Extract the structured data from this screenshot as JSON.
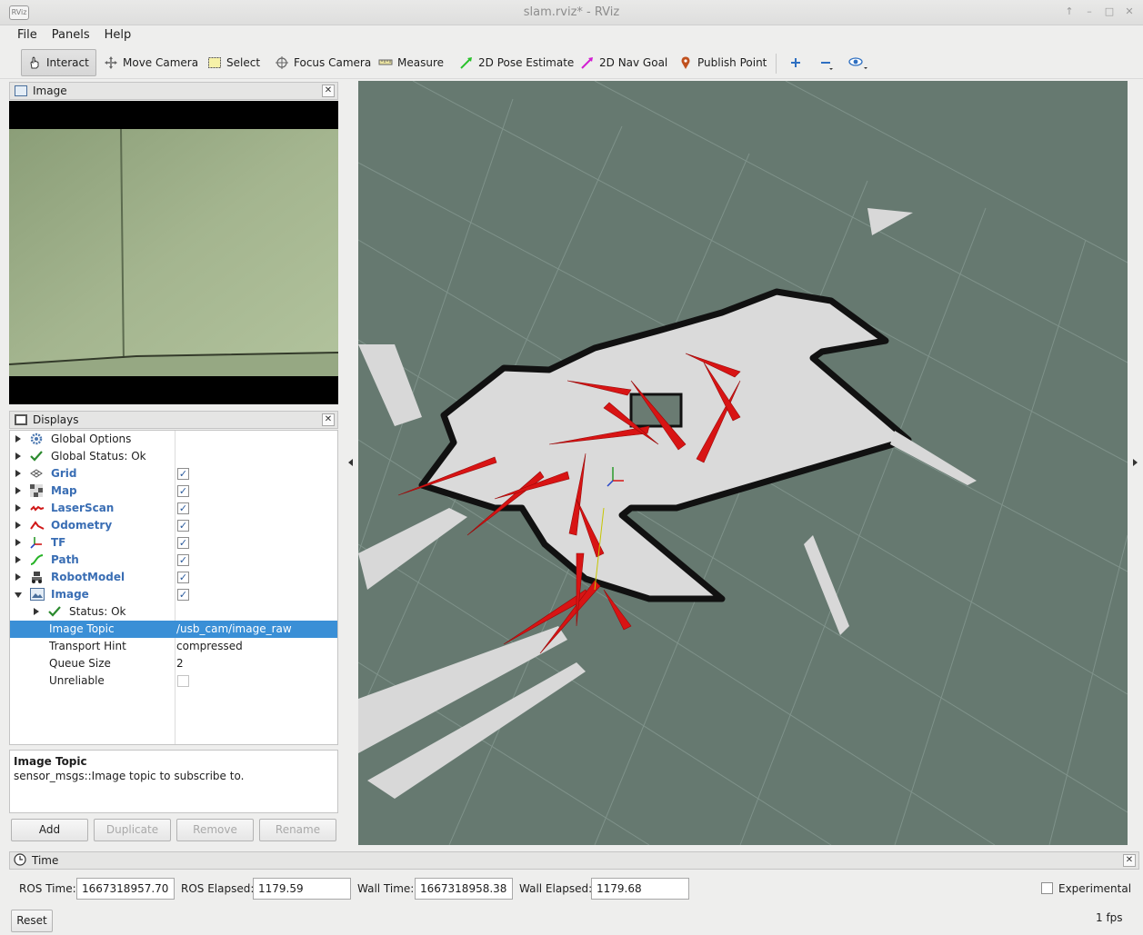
{
  "window": {
    "title": "slam.rviz* - RViz",
    "app_icon": "RViz"
  },
  "menu": [
    "File",
    "Panels",
    "Help"
  ],
  "toolbar": {
    "interact": "Interact",
    "move_camera": "Move Camera",
    "select": "Select",
    "focus_camera": "Focus Camera",
    "measure": "Measure",
    "pose_estimate": "2D Pose Estimate",
    "nav_goal": "2D Nav Goal",
    "publish_point": "Publish Point"
  },
  "image_panel": {
    "title": "Image"
  },
  "displays_panel": {
    "title": "Displays",
    "items": [
      {
        "label": "Global Options"
      },
      {
        "label": "Global Status: Ok"
      },
      {
        "label": "Grid"
      },
      {
        "label": "Map"
      },
      {
        "label": "LaserScan"
      },
      {
        "label": "Odometry"
      },
      {
        "label": "TF"
      },
      {
        "label": "Path"
      },
      {
        "label": "RobotModel"
      },
      {
        "label": "Image"
      }
    ],
    "status": "Status: Ok",
    "properties": [
      {
        "name": "Image Topic",
        "value": "/usb_cam/image_raw"
      },
      {
        "name": "Transport Hint",
        "value": "compressed"
      },
      {
        "name": "Queue Size",
        "value": "2"
      },
      {
        "name": "Unreliable",
        "value": ""
      }
    ]
  },
  "description": {
    "title": "Image Topic",
    "text": "sensor_msgs::Image topic to subscribe to."
  },
  "buttons": {
    "add": "Add",
    "duplicate": "Duplicate",
    "remove": "Remove",
    "rename": "Rename"
  },
  "time_panel": {
    "title": "Time",
    "ros_time_label": "ROS Time:",
    "ros_time": "1667318957.70",
    "ros_elapsed_label": "ROS Elapsed:",
    "ros_elapsed": "1179.59",
    "wall_time_label": "Wall Time:",
    "wall_time": "1667318958.38",
    "wall_elapsed_label": "Wall Elapsed:",
    "wall_elapsed": "1179.68",
    "experimental_label": "Experimental",
    "reset": "Reset",
    "fps": "1 fps"
  },
  "colors": {
    "viewport_bg": "#667970",
    "selection": "#3a8fd6",
    "arrow_red": "#d81414",
    "display_label": "#3a6eb4"
  }
}
